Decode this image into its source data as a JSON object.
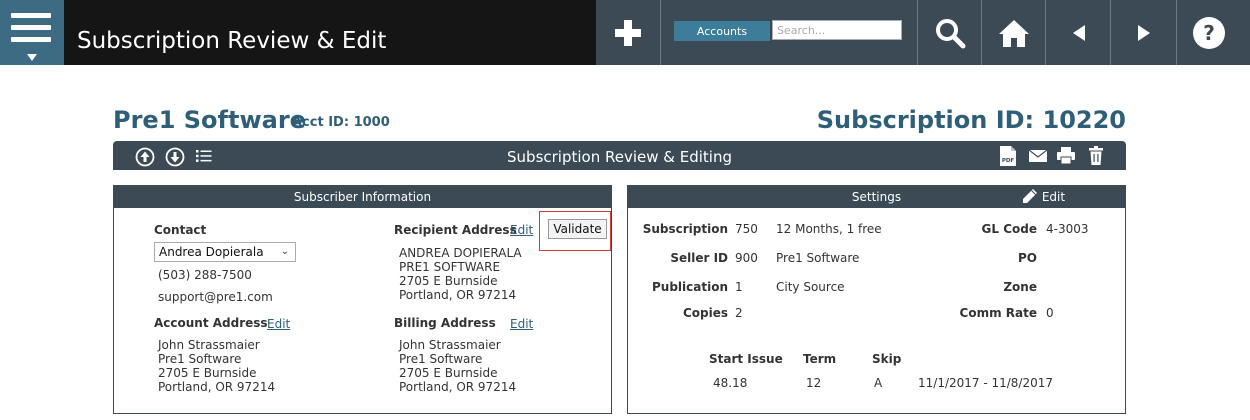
{
  "header": {
    "title": "Subscription Review & Edit",
    "accounts_label": "Accounts",
    "search_placeholder": "Search..."
  },
  "page": {
    "company": "Pre1 Software",
    "acct_id": "Acct ID: 1000",
    "subscription_id": "Subscription ID: 10220",
    "section_title": "Subscription Review & Editing"
  },
  "subscriber": {
    "title": "Subscriber Information",
    "contact_label": "Contact",
    "contact_selected": "Andrea Dopierala",
    "phone": "(503) 288-7500",
    "email": "support@pre1.com",
    "recipient_label": "Recipient Address",
    "recipient_edit": "Edit",
    "validate_label": "Validate",
    "recipient_lines": [
      "ANDREA DOPIERALA",
      "PRE1 SOFTWARE",
      "2705 E Burnside",
      "Portland, OR 97214"
    ],
    "account_label": "Account Address",
    "account_edit": "Edit",
    "account_lines": [
      "John Strassmaier",
      "Pre1 Software",
      "2705 E Burnside",
      "Portland, OR 97214"
    ],
    "billing_label": "Billing Address",
    "billing_edit": "Edit",
    "billing_lines": [
      "John Strassmaier",
      "Pre1 Software",
      "2705 E Burnside",
      "Portland, OR 97214"
    ]
  },
  "settings": {
    "title": "Settings",
    "edit_label": "Edit",
    "subscription_label": "Subscription",
    "subscription_value": "750",
    "subscription_desc": "12 Months, 1 free",
    "seller_label": "Seller ID",
    "seller_value": "900",
    "seller_desc": "Pre1 Software",
    "publication_label": "Publication",
    "publication_value": "1",
    "publication_desc": "City Source",
    "copies_label": "Copies",
    "copies_value": "2",
    "glcode_label": "GL Code",
    "glcode_value": "4-3003",
    "po_label": "PO",
    "zone_label": "Zone",
    "comm_label": "Comm Rate",
    "comm_value": "0",
    "start_issue_label": "Start Issue",
    "term_label": "Term",
    "skip_label": "Skip",
    "start_issue_value": "48.18",
    "term_value": "12",
    "skip_value": "A",
    "date_range": "11/1/2017 - 11/8/2017"
  }
}
